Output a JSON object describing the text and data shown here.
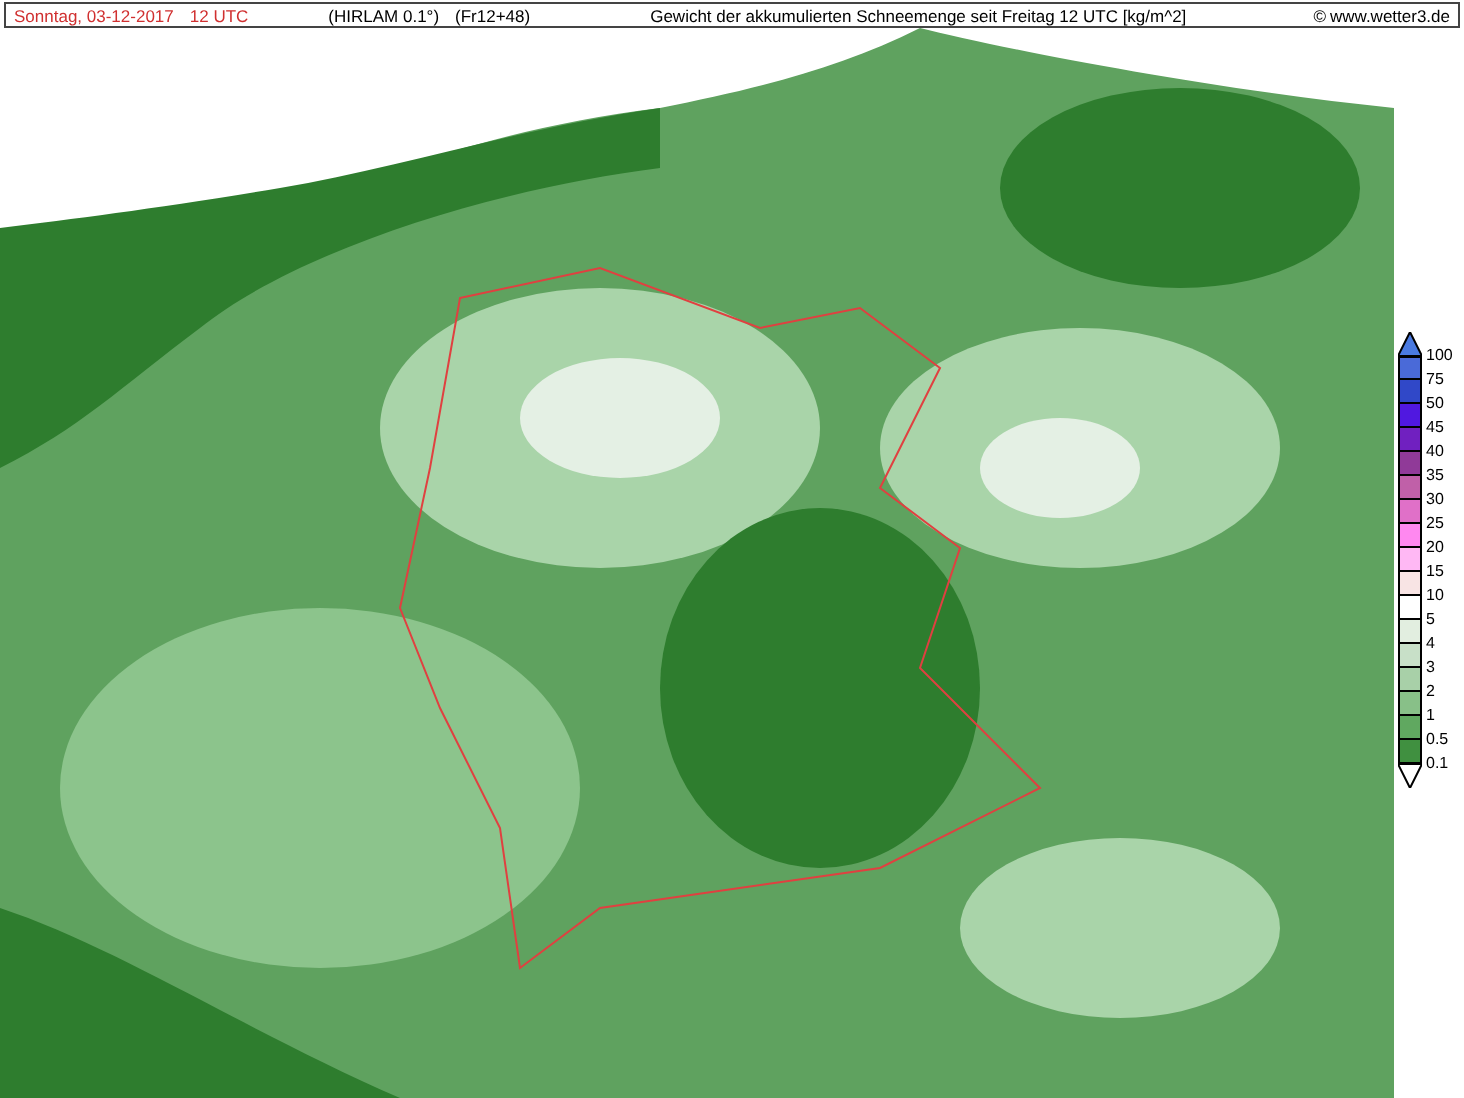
{
  "header": {
    "date": "Sonntag, 03-12-2017",
    "time": "12 UTC",
    "model": "(HIRLAM 0.1°)",
    "run": "(Fr12+48)",
    "title": "Gewicht der akkumulierten Schneemenge seit Freitag 12 UTC [kg/m^2]",
    "copyright": "©",
    "site": "www.wetter3.de"
  },
  "legend": {
    "items": [
      {
        "label": "100",
        "color": "#4a6ad8"
      },
      {
        "label": "75",
        "color": "#3048c8"
      },
      {
        "label": "50",
        "color": "#5018e0"
      },
      {
        "label": "45",
        "color": "#7020c0"
      },
      {
        "label": "40",
        "color": "#903a98"
      },
      {
        "label": "35",
        "color": "#c060a8"
      },
      {
        "label": "30",
        "color": "#e070c8"
      },
      {
        "label": "25",
        "color": "#ff88f0"
      },
      {
        "label": "20",
        "color": "#ffb8f4"
      },
      {
        "label": "15",
        "color": "#f8e4e4"
      },
      {
        "label": "10",
        "color": "#ffffff"
      },
      {
        "label": "5",
        "color": "#e2eee0"
      },
      {
        "label": "4",
        "color": "#c8e0c8"
      },
      {
        "label": "3",
        "color": "#a8d0a8"
      },
      {
        "label": "2",
        "color": "#88c088"
      },
      {
        "label": "1",
        "color": "#60a860"
      },
      {
        "label": "0.5",
        "color": "#409040"
      }
    ],
    "bottom_label": "0.1"
  }
}
